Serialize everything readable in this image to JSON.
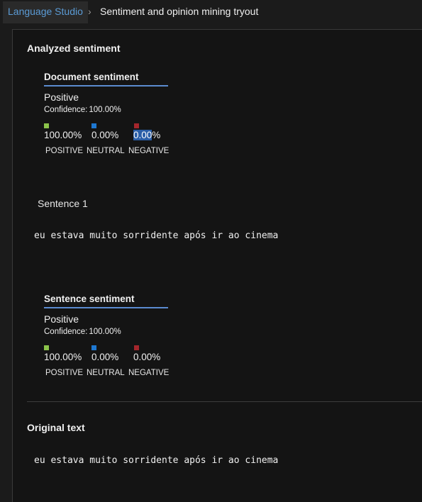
{
  "breadcrumb": {
    "root": "Language Studio",
    "separator": "›",
    "current": "Sentiment and opinion mining tryout"
  },
  "analyzed": {
    "title": "Analyzed sentiment",
    "document_card": {
      "title": "Document sentiment",
      "label": "Positive",
      "confidence_label": "Confidence:",
      "confidence_value": "100.00%",
      "positive_pct": "100.00%",
      "neutral_pct": "0.00%",
      "negative_pct_highlight": "0.00",
      "negative_pct_rest": "%",
      "positive_label": "POSITIVE",
      "neutral_label": "NEUTRAL",
      "negative_label": "NEGATIVE"
    },
    "sentence": {
      "label": "Sentence 1",
      "text": "eu estava muito sorridente após ir ao cinema"
    },
    "sentence_card": {
      "title": "Sentence sentiment",
      "label": "Positive",
      "confidence_label": "Confidence:",
      "confidence_value": "100.00%",
      "positive_pct": "100.00%",
      "neutral_pct": "0.00%",
      "negative_pct": "0.00%",
      "positive_label": "POSITIVE",
      "neutral_label": "NEUTRAL",
      "negative_label": "NEGATIVE"
    }
  },
  "original": {
    "title": "Original text",
    "text": "eu estava muito sorridente após ir ao cinema"
  },
  "colors": {
    "positive": "#8bc34a",
    "neutral": "#1e78d2",
    "negative": "#a4262c",
    "accent": "#5b8bd0"
  }
}
